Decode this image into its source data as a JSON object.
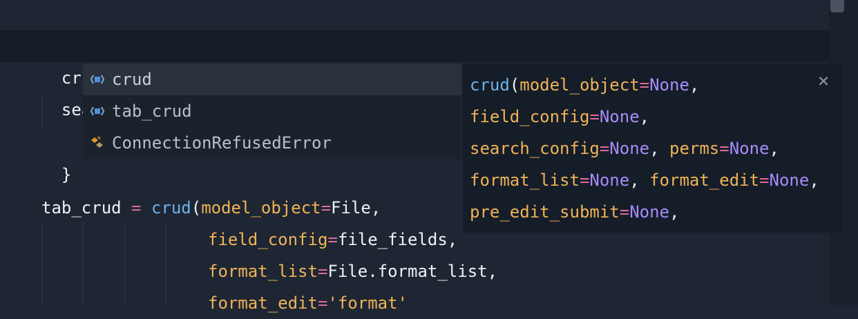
{
  "editor": {
    "line1": "crud",
    "line2_prefix": "sear",
    "line4": "}",
    "line6": {
      "lhs": "tab_crud",
      "eq": "=",
      "fn": "crud",
      "open": "(",
      "kw": "model_object",
      "kw_eq": "=",
      "val": "File",
      "comma": ","
    },
    "line7": {
      "kw": "field_config",
      "eq": "=",
      "val": "file_fields",
      "comma": ","
    },
    "line8": {
      "kw": "format_list",
      "eq": "=",
      "val": "File.format_list",
      "comma": ","
    },
    "line9": {
      "kw": "format_edit",
      "eq": "=",
      "val": "'format'"
    }
  },
  "autocomplete": {
    "items": [
      {
        "label": "crud",
        "icon": "function-icon"
      },
      {
        "label": "tab_crud",
        "icon": "function-icon"
      },
      {
        "label": "ConnectionRefusedError",
        "icon": "class-icon"
      }
    ]
  },
  "signature": {
    "close_label": "×",
    "fn": "crud",
    "open": "(",
    "params": [
      {
        "name": "model_object",
        "eq": "=",
        "default": "None"
      },
      {
        "name": "field_config",
        "eq": "=",
        "default": "None"
      },
      {
        "name": "search_config",
        "eq": "=",
        "default": "None"
      },
      {
        "name": "perms",
        "eq": "=",
        "default": "None"
      },
      {
        "name": "format_list",
        "eq": "=",
        "default": "None"
      },
      {
        "name": "format_edit",
        "eq": "=",
        "default": "None"
      },
      {
        "name": "pre_edit_submit",
        "eq": "=",
        "default": "None"
      }
    ],
    "sep": ",",
    "sep_space": ", "
  },
  "colors": {
    "background": "#1e2633",
    "current_line": "#151d28",
    "function": "#6cb2eb",
    "keyword_arg": "#f0b357",
    "operator": "#e06c9f",
    "constant": "#a78bfa"
  }
}
